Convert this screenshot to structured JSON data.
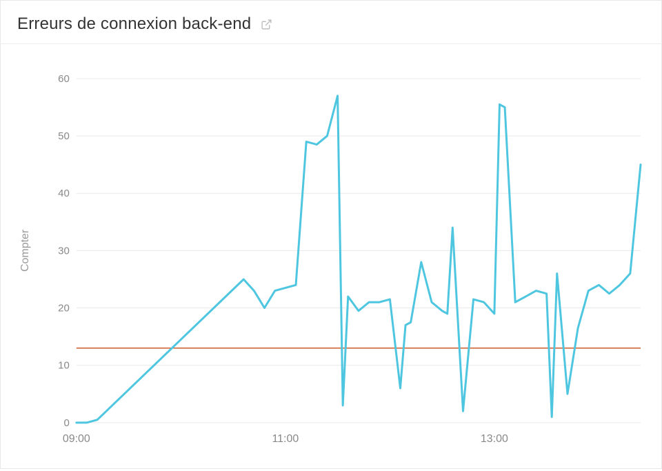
{
  "header": {
    "title": "Erreurs de connexion back-end"
  },
  "icons": {
    "external": "external-link-icon"
  },
  "chart_data": {
    "type": "line",
    "title": "Erreurs de connexion back-end",
    "xlabel": "",
    "ylabel": "Compter",
    "ylim": [
      0,
      60
    ],
    "y_ticks": [
      0,
      10,
      20,
      30,
      40,
      50,
      60
    ],
    "x_ticks": [
      "09:00",
      "11:00",
      "13:00"
    ],
    "x_tick_values": [
      9.0,
      11.0,
      13.0
    ],
    "xlim": [
      9.0,
      14.4
    ],
    "threshold": 13,
    "colors": {
      "line": "#4fc6e0",
      "threshold": "#cc5b29",
      "grid": "#e9e9e9"
    },
    "series": [
      {
        "name": "errors",
        "x": [
          9.0,
          9.1,
          9.2,
          10.6,
          10.7,
          10.8,
          10.9,
          11.0,
          11.1,
          11.2,
          11.3,
          11.4,
          11.5,
          11.55,
          11.6,
          11.7,
          11.8,
          11.9,
          12.0,
          12.1,
          12.15,
          12.2,
          12.3,
          12.4,
          12.5,
          12.55,
          12.6,
          12.7,
          12.8,
          12.9,
          13.0,
          13.05,
          13.1,
          13.2,
          13.3,
          13.4,
          13.5,
          13.55,
          13.6,
          13.7,
          13.8,
          13.9,
          14.0,
          14.1,
          14.2,
          14.3,
          14.4
        ],
        "values": [
          0,
          0,
          0.5,
          25,
          23,
          20,
          23,
          23.5,
          24,
          49,
          48.5,
          50,
          57,
          3,
          22,
          19.5,
          21,
          21,
          21.5,
          6,
          17,
          17.5,
          28,
          21,
          19.5,
          19,
          34,
          2,
          21.5,
          21,
          19,
          55.5,
          55,
          21,
          22,
          23,
          22.5,
          1,
          26,
          5,
          16.5,
          23,
          24,
          22.5,
          24,
          26,
          45
        ]
      }
    ]
  }
}
